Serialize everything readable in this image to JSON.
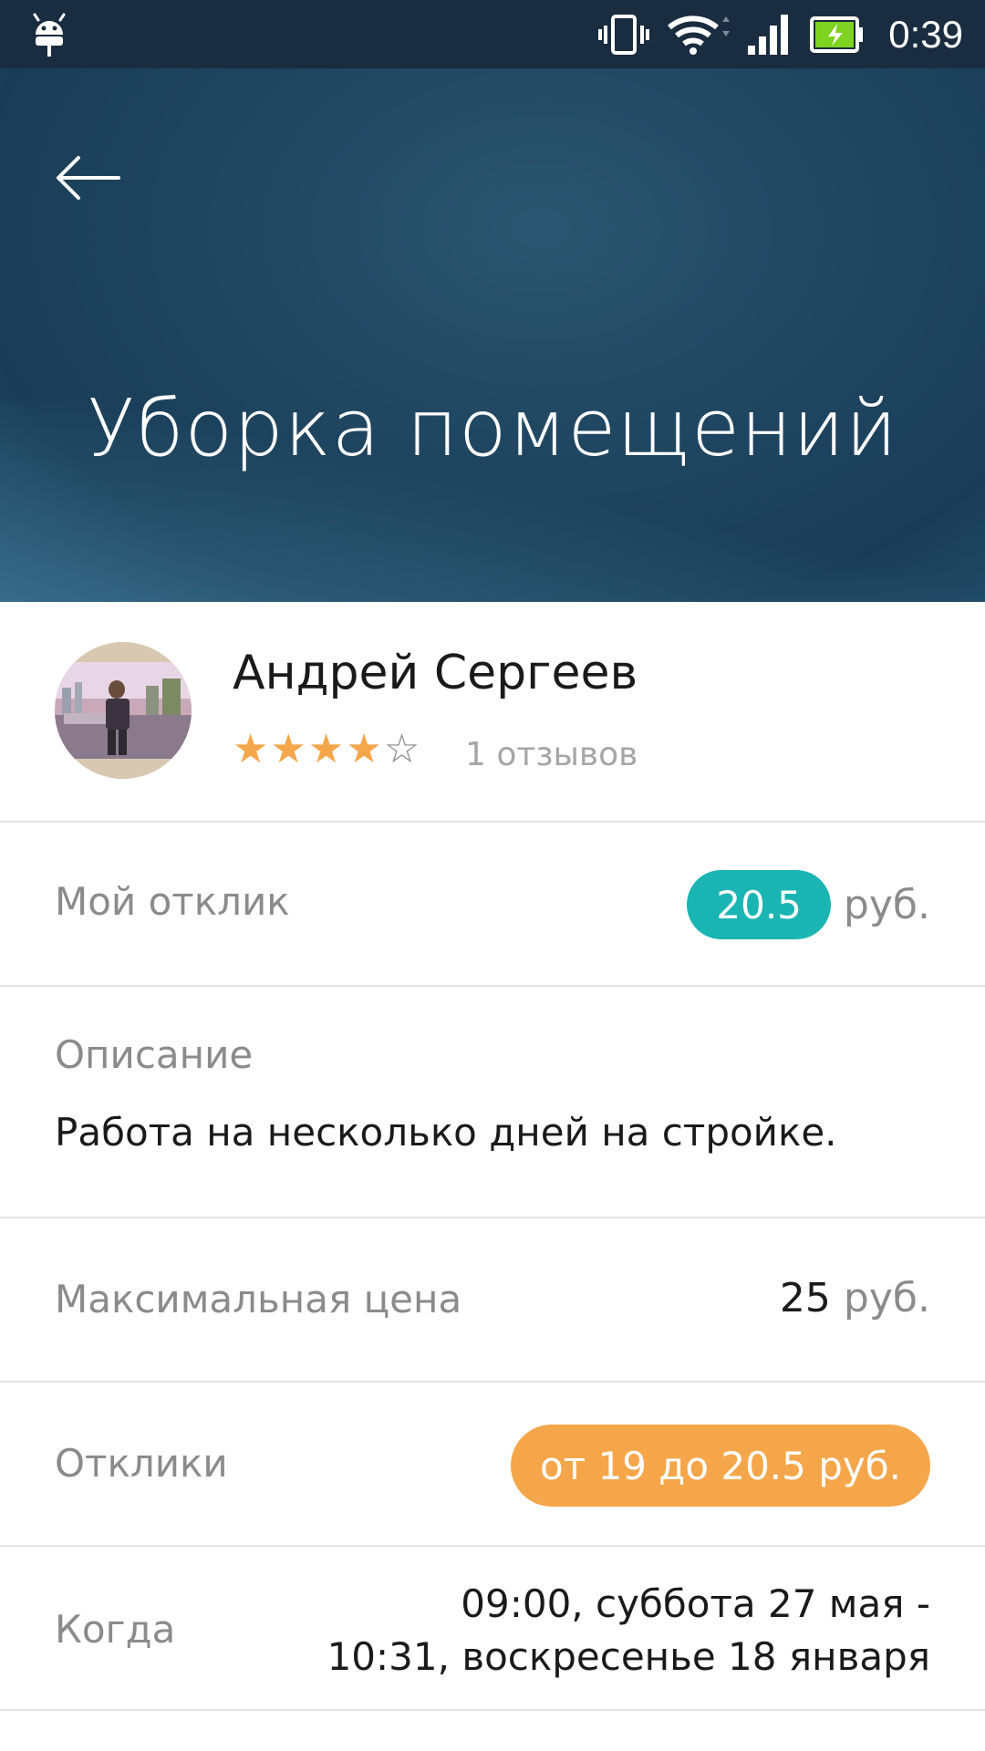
{
  "status_bar": {
    "time": "0:39",
    "icons": [
      "android-debug-icon",
      "vibrate-icon",
      "wifi-icon",
      "signal-icon",
      "battery-charging-icon"
    ],
    "battery_color": "#7ed321"
  },
  "header": {
    "title": "Уборка помещений",
    "back_icon": "arrow-left-icon"
  },
  "profile": {
    "name": "Андрей Сергеев",
    "rating": 4,
    "rating_max": 5,
    "reviews": "1 отзывов"
  },
  "my_response": {
    "label": "Мой отклик",
    "value": "20.5",
    "currency": "руб."
  },
  "description": {
    "label": "Описание",
    "text": "Работа на несколько дней на стройке."
  },
  "max_price": {
    "label": "Максимальная цена",
    "value": "25",
    "currency": "руб."
  },
  "responses": {
    "label": "Отклики",
    "range": "от 19 до 20.5 руб."
  },
  "when": {
    "label": "Когда",
    "line1": "09:00, суббота 27 мая -",
    "line2": "10:31, воскресенье 18 января"
  },
  "colors": {
    "accent_teal": "#1ab5b3",
    "accent_orange": "#f5a64a",
    "header_bg": "#1f4560",
    "star": "#f5a64a"
  }
}
